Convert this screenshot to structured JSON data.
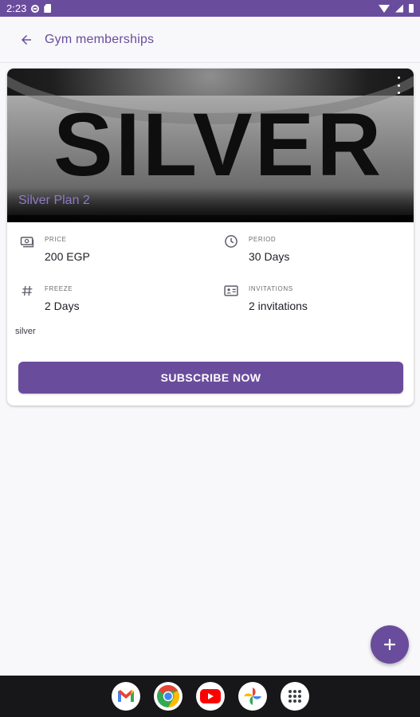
{
  "status_bar": {
    "time": "2:23",
    "icons": [
      "notification-circle-icon",
      "sim-card-icon",
      "wifi-icon",
      "cell-signal-icon",
      "battery-icon"
    ]
  },
  "app_bar": {
    "back_icon": "arrow-back-icon",
    "title": "Gym memberships"
  },
  "membership_card": {
    "image_text": "SILVER",
    "plan_name": "Silver Plan 2",
    "menu_icon": "more-vert-icon",
    "details": [
      {
        "icon": "cash-icon",
        "label": "PRICE",
        "value": "200 EGP"
      },
      {
        "icon": "clock-icon",
        "label": "PERIOD",
        "value": "30 Days"
      },
      {
        "icon": "hash-icon",
        "label": "FREEZE",
        "value": "2 Days"
      },
      {
        "icon": "id-card-icon",
        "label": "INVITATIONS",
        "value": "2 invitations"
      }
    ],
    "description": "silver",
    "subscribe_label": "SUBSCRIBE NOW"
  },
  "fab": {
    "icon": "plus-icon",
    "label": "+"
  },
  "taskbar": {
    "apps": [
      "gmail-icon",
      "chrome-icon",
      "youtube-icon",
      "photos-icon",
      "app-drawer-icon"
    ]
  },
  "colors": {
    "primary": "#6a4c9c",
    "plan_name": "#8f79c6",
    "background": "#f8f8fb",
    "taskbar": "#17171a"
  }
}
